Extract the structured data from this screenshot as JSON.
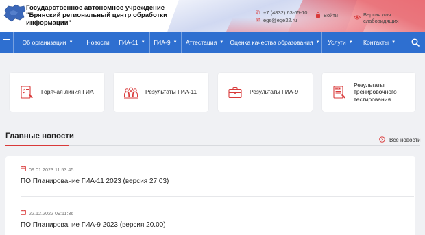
{
  "header": {
    "org_name": "Государственное автономное учреждение \"Брянский региональный центр обработки информации\"",
    "phone": "+7 (4832) 63-65-10",
    "email": "egs@ege32.ru",
    "login_label": "Войти",
    "accessibility_label": "Версия для слабовидящих",
    "icons": {
      "logo": "bryansk-region-map-logo",
      "phone": "phone-icon",
      "email": "mail-icon",
      "login": "lock-icon",
      "accessibility": "eye-icon"
    },
    "colors": {
      "accent": "#d93a3a"
    }
  },
  "nav": {
    "background": "#2e6fd0",
    "items": [
      {
        "label": "Об организации",
        "dropdown": true
      },
      {
        "label": "Новости",
        "dropdown": false
      },
      {
        "label": "ГИА-11",
        "dropdown": true
      },
      {
        "label": "ГИА-9",
        "dropdown": true
      },
      {
        "label": "Аттестация",
        "dropdown": true
      },
      {
        "label": "Оценка качества образования",
        "dropdown": true
      },
      {
        "label": "Услуги",
        "dropdown": true
      },
      {
        "label": "Контакты",
        "dropdown": true
      }
    ],
    "icons": {
      "menu": "hamburger-icon",
      "search": "search-icon",
      "dropdown": "chevron-down-icon"
    }
  },
  "quick_links": [
    {
      "label": "Горячая линия ГИА",
      "icon": "document-checklist-icon"
    },
    {
      "label": "Результаты ГИА-11",
      "icon": "people-group-icon"
    },
    {
      "label": "Результаты ГИА-9",
      "icon": "briefcase-icon"
    },
    {
      "label": "Результаты тренировочного тестирования",
      "icon": "test-sheet-icon"
    }
  ],
  "news": {
    "title": "Главные новости",
    "all_news_label": "Все новости",
    "items": [
      {
        "date": "09.01.2023 11:53:45",
        "headline": "ПО Планирование ГИА-11 2023 (версия 27.03)"
      },
      {
        "date": "22.12.2022 09:11:36",
        "headline": "ПО Планирование ГИА-9 2023 (версия 20.00)"
      }
    ],
    "icons": {
      "date": "calendar-icon",
      "all_news": "arrow-circle-right-icon"
    }
  }
}
